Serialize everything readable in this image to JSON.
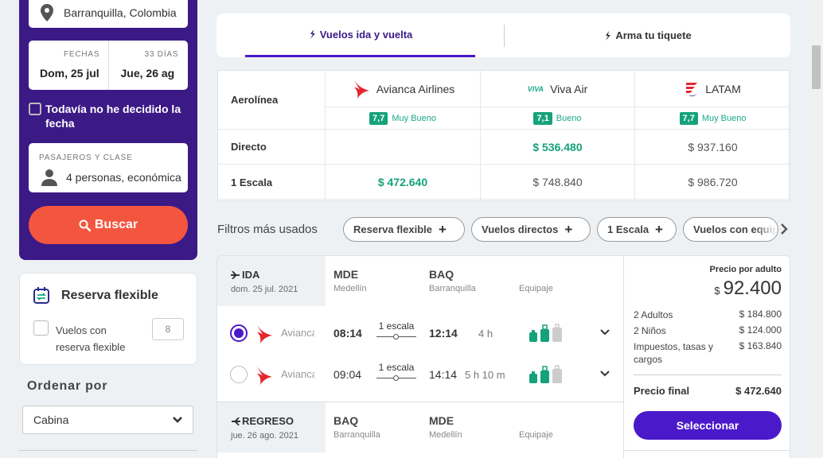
{
  "search": {
    "origin": "Barranquilla, Colombia",
    "dates_label": "FECHAS",
    "nights_label": "33 DÍAS",
    "depart": "Dom, 25 jul",
    "return": "Jue, 26 ag",
    "undecided": "Todavía no he decidido la fecha",
    "pax_label": "PASAJEROS Y CLASE",
    "pax_value": "4 personas, económica",
    "search_button": "Buscar"
  },
  "flexible": {
    "title": "Reserva flexible",
    "option": "Vuelos con reserva flexible",
    "count": "8"
  },
  "sort": {
    "title": "Ordenar por",
    "value": "Cabina"
  },
  "tabs": [
    {
      "label": "Vuelos ida y vuelta"
    },
    {
      "label": "Arma tu tiquete"
    }
  ],
  "matrix": {
    "row_labels": [
      "Aerolínea",
      "Directo",
      "1 Escala"
    ],
    "airlines": [
      {
        "name": "Avianca Airlines",
        "score": "7,7",
        "rating": "Muy Bueno",
        "direct": "",
        "one_stop": "$ 472.640"
      },
      {
        "name": "Viva Air",
        "logo_text": "VIVA",
        "score": "7,1",
        "rating": "Bueno",
        "direct": "$ 536.480",
        "one_stop": "$ 748.840"
      },
      {
        "name": "LATAM",
        "score": "7,7",
        "rating": "Muy Bueno",
        "direct": "$ 937.160",
        "one_stop": "$ 986.720"
      }
    ]
  },
  "filters": {
    "label": "Filtros más usados",
    "chips": [
      "Reserva flexible",
      "Vuelos directos",
      "1 Escala",
      "Vuelos con equipaje"
    ]
  },
  "flight": {
    "outbound": {
      "label": "IDA",
      "date": "dom. 25 jul. 2021",
      "from_code": "MDE",
      "from_city": "Medellín",
      "to_code": "BAQ",
      "to_city": "Barranquilla",
      "baggage_label": "Equipaje",
      "options": [
        {
          "airline": "Avianca",
          "dep": "08:14",
          "stops": "1 escala",
          "arr": "12:14",
          "duration": "4 h"
        },
        {
          "airline": "Avianca",
          "dep": "09:04",
          "stops": "1 escala",
          "arr": "14:14",
          "duration": "5 h 10 m"
        }
      ]
    },
    "return": {
      "label": "REGRESO",
      "date": "jue. 26 ago. 2021",
      "from_code": "BAQ",
      "from_city": "Barranquilla",
      "to_code": "MDE",
      "to_city": "Medellín",
      "baggage_label": "Equipaje"
    },
    "price": {
      "per_adult_label": "Precio por adulto",
      "currency": "$",
      "per_adult": "92.400",
      "lines": [
        {
          "k": "2 Adultos",
          "v": "$ 184.800"
        },
        {
          "k": "2 Niños",
          "v": "$ 124.000"
        },
        {
          "k": "Impuestos, tasas y cargos",
          "v": "$ 163.840"
        }
      ],
      "final_label": "Precio final",
      "final_value": "$ 472.640",
      "select_button": "Seleccionar"
    }
  },
  "colors": {
    "panel": "#3b1a86",
    "accent": "#4a19c9",
    "search_button": "#f3553f",
    "good_price": "#15a27a"
  }
}
